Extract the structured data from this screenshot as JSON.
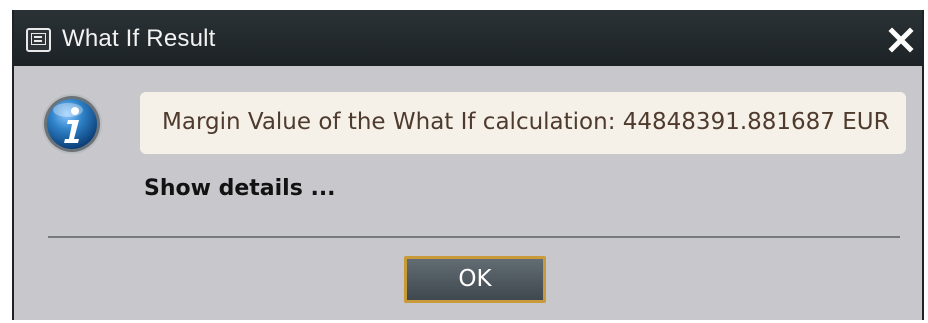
{
  "window": {
    "title": "What If Result",
    "app_icon": "console-window-icon",
    "close_icon": "close-icon"
  },
  "message": {
    "icon": "info-icon",
    "text": "Margin Value of the What If calculation: 44848391.881687 EUR"
  },
  "details": {
    "label": "Show details ..."
  },
  "footer": {
    "ok_label": "OK"
  },
  "colors": {
    "title_bar": "#1c2225",
    "dialog_background": "#c8c8cc",
    "message_background": "#f6f1e8",
    "message_text": "#4e3b2d",
    "ok_border": "#c89a3a",
    "info_icon_blue": "#2f82c8"
  }
}
